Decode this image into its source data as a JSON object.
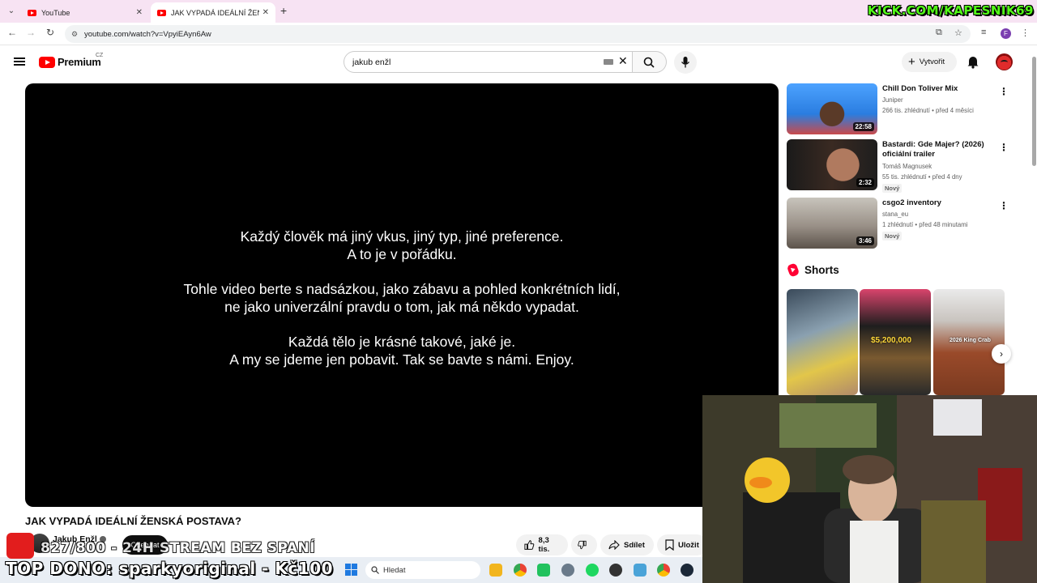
{
  "browser": {
    "tabs": [
      {
        "title": "YouTube",
        "active": false
      },
      {
        "title": "JAK VYPADÁ IDEÁLNÍ ŽENSKÁ P",
        "active": true
      }
    ],
    "url": "youtube.com/watch?v=VpyiEAyn6Aw",
    "stream_banner": "KICK.COM/KAPESNIK69"
  },
  "yt_header": {
    "logo_text": "Premium",
    "logo_country": "CZ",
    "search_value": "jakub enžl",
    "create_label": "Vytvořit"
  },
  "player": {
    "lines": [
      "Každý člověk má jiný vkus, jiný typ, jiné preference.",
      "A to je v pořádku.",
      "Tohle video berte s nadsázkou, jako zábavu a pohled konkrétních lidí,",
      "ne jako univerzální pravdu o tom, jak má někdo vypadat.",
      "Každá tělo je krásné takové, jaké je.",
      "A my se jdeme jen pobavit. Tak se bavte s námi. Enjoy."
    ]
  },
  "video": {
    "title": "JAK VYPADÁ IDEÁLNÍ ŽENSKÁ POSTAVA?",
    "channel": "Jakub Enžl",
    "subscribe_label": "Odebírat",
    "likes": "8,3 tis.",
    "share_label": "Sdílet",
    "save_label": "Uložit"
  },
  "recommendations": [
    {
      "title": "Chill Don Toliver Mix",
      "channel": "Juniper",
      "meta": "266 tis. zhlédnutí • před 4 měsíci",
      "duration": "22:58",
      "badge": ""
    },
    {
      "title": "Bastardi: Gde Majer? (2026) oficiální trailer",
      "channel": "Tomáš Magnusek",
      "meta": "55 tis. zhlédnutí • před 4 dny",
      "duration": "2:32",
      "badge": "Nový"
    },
    {
      "title": "csgo2 inventory",
      "channel": "stana_eu",
      "meta": "1 zhlédnutí • před 48 minutami",
      "duration": "3:46",
      "badge": "Nový"
    }
  ],
  "shorts": {
    "label": "Shorts",
    "items": [
      {
        "caption": ""
      },
      {
        "caption": "$5,200,000"
      },
      {
        "caption": "2026 King Crab"
      }
    ]
  },
  "overlay": {
    "goal_text": "827/800 - 24H STREAM BEZ SPANÍ",
    "top_donor": "TOP DONO: sparkyoriginal - Kč100"
  },
  "taskbar": {
    "search_placeholder": "Hledat"
  },
  "colors": {
    "yt_red": "#ff0000",
    "kick_green": "#53fc18",
    "tab_strip": "#f7e3f3"
  }
}
